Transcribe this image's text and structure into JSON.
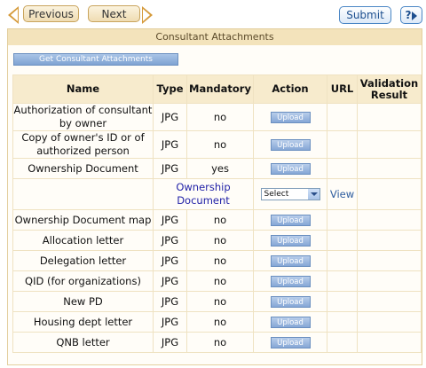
{
  "nav": {
    "previous_label": "Previous",
    "next_label": "Next",
    "submit_label": "Submit",
    "help_label": "?"
  },
  "panel": {
    "title": "Consultant Attachments",
    "get_button_label": "Get Consultant Attachments"
  },
  "table": {
    "headers": {
      "name": "Name",
      "type": "Type",
      "mandatory": "Mandatory",
      "action": "Action",
      "url": "URL",
      "validation": "Validation Result"
    },
    "upload_label": "Upload",
    "rows": [
      {
        "name": "Authorization of consultant by owner",
        "type": "JPG",
        "mandatory": "no"
      },
      {
        "name": "Copy of owner's ID or of authorized person",
        "type": "JPG",
        "mandatory": "no"
      },
      {
        "name": "Ownership Document",
        "type": "JPG",
        "mandatory": "yes"
      },
      {
        "name": "Ownership Document map",
        "type": "JPG",
        "mandatory": "no"
      },
      {
        "name": "Allocation letter",
        "type": "JPG",
        "mandatory": "no"
      },
      {
        "name": "Delegation letter",
        "type": "JPG",
        "mandatory": "no"
      },
      {
        "name": "QID (for organizations)",
        "type": "JPG",
        "mandatory": "no"
      },
      {
        "name": "New PD",
        "type": "JPG",
        "mandatory": "no"
      },
      {
        "name": "Housing dept letter",
        "type": "JPG",
        "mandatory": "no"
      },
      {
        "name": "QNB letter",
        "type": "JPG",
        "mandatory": "no"
      }
    ],
    "sub_row": {
      "link": "Ownership Document",
      "select_value": "Select",
      "view_label": "View"
    }
  },
  "colors": {
    "accent": "#d59a3a",
    "header_bg": "#f7ebcd",
    "button_blue": "#86a7d6"
  }
}
